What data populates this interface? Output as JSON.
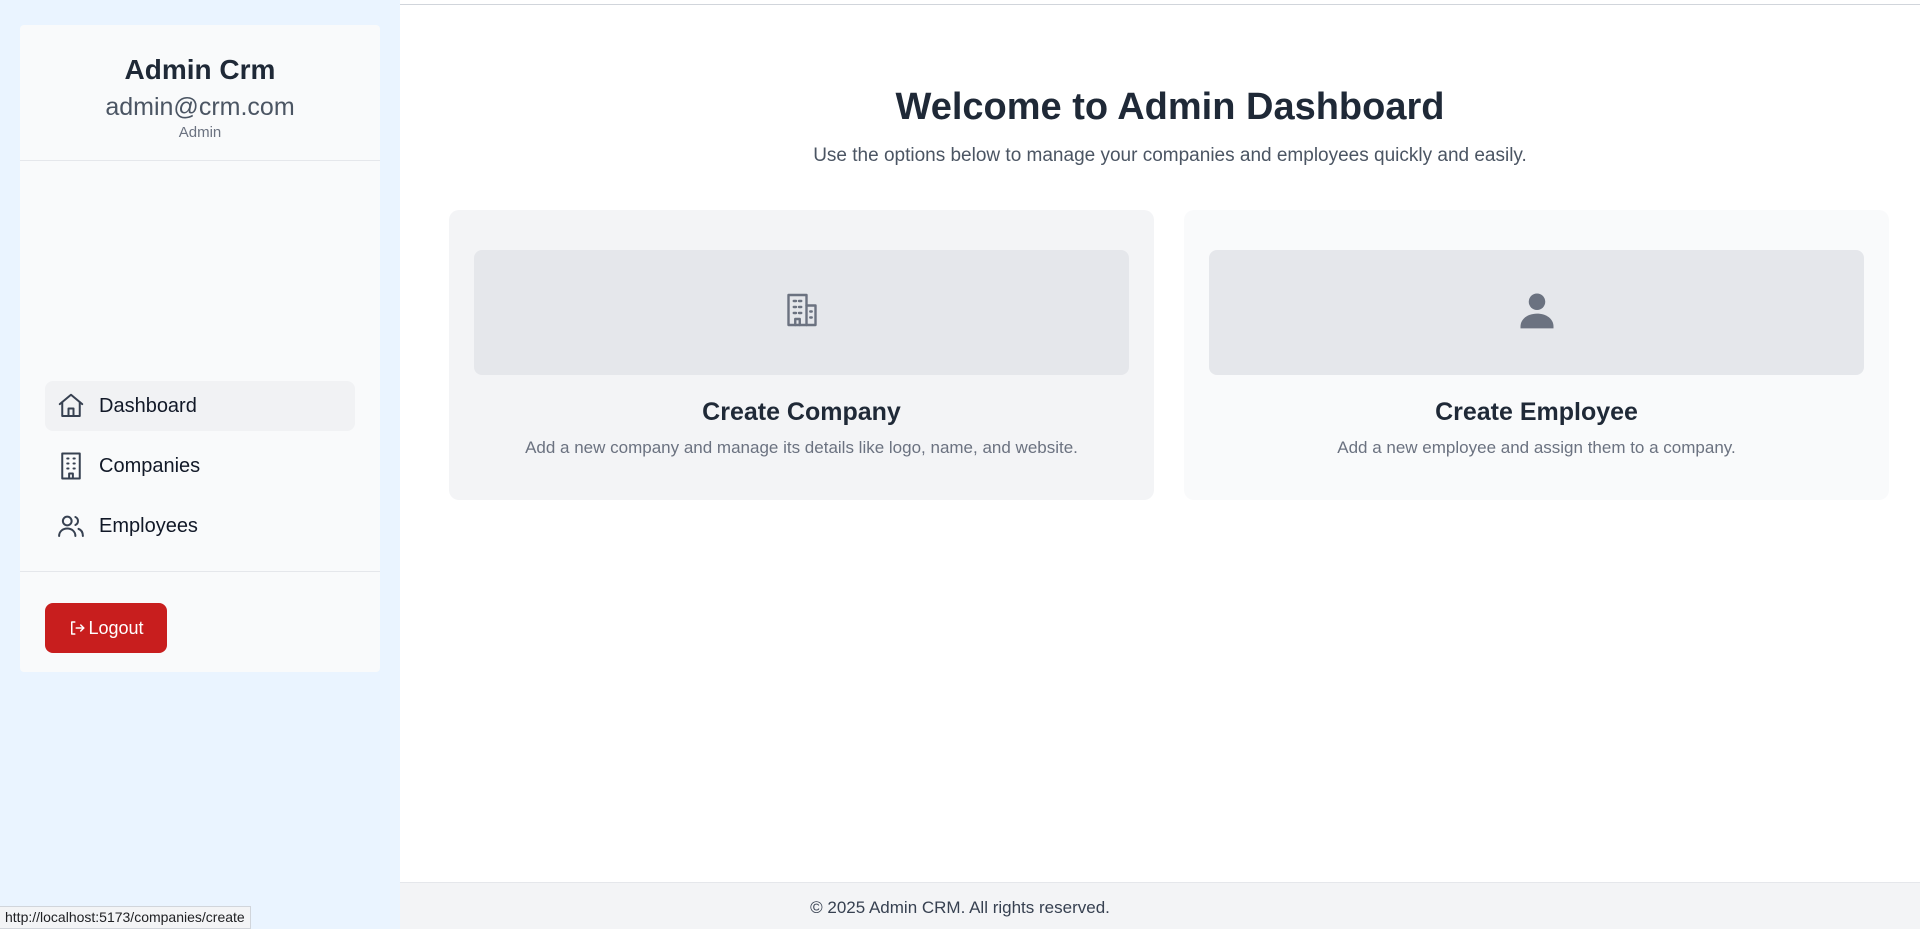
{
  "sidebar": {
    "profile": {
      "name": "Admin Crm",
      "email": "admin@crm.com",
      "role": "Admin"
    },
    "nav": [
      {
        "label": "Dashboard",
        "icon": "home-icon",
        "active": true
      },
      {
        "label": "Companies",
        "icon": "building-icon",
        "active": false
      },
      {
        "label": "Employees",
        "icon": "users-icon",
        "active": false
      }
    ],
    "logout_label": "Logout",
    "logout_icon": "logout-icon"
  },
  "main": {
    "title": "Welcome to Admin Dashboard",
    "subtitle": "Use the options below to manage your companies and employees quickly and easily.",
    "cards": [
      {
        "title": "Create Company",
        "description": "Add a new company and manage its details like logo, name, and website.",
        "icon": "building-icon"
      },
      {
        "title": "Create Employee",
        "description": "Add a new employee and assign them to a company.",
        "icon": "user-icon"
      }
    ]
  },
  "footer": {
    "text": "© 2025 Admin CRM. All rights reserved."
  },
  "status_bar": {
    "url": "http://localhost:5173/companies/create"
  },
  "colors": {
    "sidebar_bg": "#eaf4ff",
    "logout_button": "#c81e1e",
    "icon_gray": "#6b7280"
  }
}
